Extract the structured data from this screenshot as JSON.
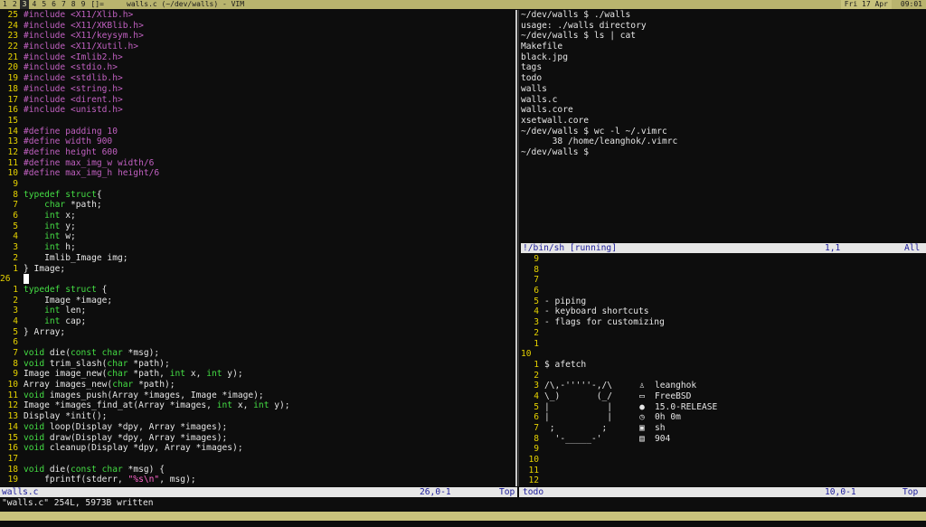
{
  "topbar": {
    "tags": [
      "1",
      "2",
      "3",
      "4",
      "5",
      "6",
      "7",
      "8",
      "9",
      "[]="
    ],
    "active_tag": "3",
    "window_title": "walls.c (~/dev/walls) - VIM",
    "date": "Fri 17 Apr",
    "time": "09:01"
  },
  "editor": {
    "lines": [
      {
        "n": "25",
        "t": [
          [
            "pp",
            "#include <X11/Xlib.h>"
          ]
        ]
      },
      {
        "n": "24",
        "t": [
          [
            "pp",
            "#include <X11/XKBlib.h>"
          ]
        ]
      },
      {
        "n": "23",
        "t": [
          [
            "pp",
            "#include <X11/keysym.h>"
          ]
        ]
      },
      {
        "n": "22",
        "t": [
          [
            "pp",
            "#include <X11/Xutil.h>"
          ]
        ]
      },
      {
        "n": "21",
        "t": [
          [
            "pp",
            "#include <Imlib2.h>"
          ]
        ]
      },
      {
        "n": "20",
        "t": [
          [
            "pp",
            "#include <stdio.h>"
          ]
        ]
      },
      {
        "n": "19",
        "t": [
          [
            "pp",
            "#include <stdlib.h>"
          ]
        ]
      },
      {
        "n": "18",
        "t": [
          [
            "pp",
            "#include <string.h>"
          ]
        ]
      },
      {
        "n": "17",
        "t": [
          [
            "pp",
            "#include <dirent.h>"
          ]
        ]
      },
      {
        "n": "16",
        "t": [
          [
            "pp",
            "#include <unistd.h>"
          ]
        ]
      },
      {
        "n": "15",
        "t": []
      },
      {
        "n": "14",
        "t": [
          [
            "pp",
            "#define padding 10"
          ]
        ]
      },
      {
        "n": "13",
        "t": [
          [
            "pp",
            "#define width 900"
          ]
        ]
      },
      {
        "n": "12",
        "t": [
          [
            "pp",
            "#define height 600"
          ]
        ]
      },
      {
        "n": "11",
        "t": [
          [
            "pp",
            "#define max_img_w width/6"
          ]
        ]
      },
      {
        "n": "10",
        "t": [
          [
            "pp",
            "#define max_img_h height/6"
          ]
        ]
      },
      {
        "n": "9",
        "t": []
      },
      {
        "n": "8",
        "t": [
          [
            "kw",
            "typedef struct"
          ],
          [
            "",
            "{"
          ]
        ]
      },
      {
        "n": "7",
        "t": [
          [
            "",
            "    "
          ],
          [
            "ty",
            "char"
          ],
          [
            "",
            " *path;"
          ]
        ]
      },
      {
        "n": "6",
        "t": [
          [
            "",
            "    "
          ],
          [
            "ty",
            "int"
          ],
          [
            "",
            " x;"
          ]
        ]
      },
      {
        "n": "5",
        "t": [
          [
            "",
            "    "
          ],
          [
            "ty",
            "int"
          ],
          [
            "",
            " y;"
          ]
        ]
      },
      {
        "n": "4",
        "t": [
          [
            "",
            "    "
          ],
          [
            "ty",
            "int"
          ],
          [
            "",
            " w;"
          ]
        ]
      },
      {
        "n": "3",
        "t": [
          [
            "",
            "    "
          ],
          [
            "ty",
            "int"
          ],
          [
            "",
            " h;"
          ]
        ]
      },
      {
        "n": "2",
        "t": [
          [
            "",
            "    Imlib_Image img;"
          ]
        ]
      },
      {
        "n": "1",
        "t": [
          [
            "",
            "} Image;"
          ]
        ]
      },
      {
        "n": "26",
        "cur": true,
        "t": [
          [
            "cursor",
            ""
          ]
        ]
      },
      {
        "n": "1",
        "t": [
          [
            "kw",
            "typedef struct"
          ],
          [
            "",
            " {"
          ]
        ]
      },
      {
        "n": "2",
        "t": [
          [
            "",
            "    Image *image;"
          ]
        ]
      },
      {
        "n": "3",
        "t": [
          [
            "",
            "    "
          ],
          [
            "ty",
            "int"
          ],
          [
            "",
            " len;"
          ]
        ]
      },
      {
        "n": "4",
        "t": [
          [
            "",
            "    "
          ],
          [
            "ty",
            "int"
          ],
          [
            "",
            " cap;"
          ]
        ]
      },
      {
        "n": "5",
        "t": [
          [
            "",
            "} Array;"
          ]
        ]
      },
      {
        "n": "6",
        "t": []
      },
      {
        "n": "7",
        "t": [
          [
            "ty",
            "void"
          ],
          [
            "",
            " die("
          ],
          [
            "ty",
            "const char"
          ],
          [
            "",
            " *msg);"
          ]
        ]
      },
      {
        "n": "8",
        "t": [
          [
            "ty",
            "void"
          ],
          [
            "",
            " trim_slash("
          ],
          [
            "ty",
            "char"
          ],
          [
            "",
            " *path);"
          ]
        ]
      },
      {
        "n": "9",
        "t": [
          [
            "",
            "Image image_new("
          ],
          [
            "ty",
            "char"
          ],
          [
            "",
            " *path, "
          ],
          [
            "ty",
            "int"
          ],
          [
            "",
            " x, "
          ],
          [
            "ty",
            "int"
          ],
          [
            "",
            " y);"
          ]
        ]
      },
      {
        "n": "10",
        "t": [
          [
            "",
            "Array images_new("
          ],
          [
            "ty",
            "char"
          ],
          [
            "",
            " *path);"
          ]
        ]
      },
      {
        "n": "11",
        "t": [
          [
            "ty",
            "void"
          ],
          [
            "",
            " images_push(Array *images, Image *image);"
          ]
        ]
      },
      {
        "n": "12",
        "t": [
          [
            "",
            "Image *images_find_at(Array *images, "
          ],
          [
            "ty",
            "int"
          ],
          [
            "",
            " x, "
          ],
          [
            "ty",
            "int"
          ],
          [
            "",
            " y);"
          ]
        ]
      },
      {
        "n": "13",
        "t": [
          [
            "",
            "Display *init();"
          ]
        ]
      },
      {
        "n": "14",
        "t": [
          [
            "ty",
            "void"
          ],
          [
            "",
            " loop(Display *dpy, Array *images);"
          ]
        ]
      },
      {
        "n": "15",
        "t": [
          [
            "ty",
            "void"
          ],
          [
            "",
            " draw(Display *dpy, Array *images);"
          ]
        ]
      },
      {
        "n": "16",
        "t": [
          [
            "ty",
            "void"
          ],
          [
            "",
            " cleanup(Display *dpy, Array *images);"
          ]
        ]
      },
      {
        "n": "17",
        "t": []
      },
      {
        "n": "18",
        "t": [
          [
            "ty",
            "void"
          ],
          [
            "",
            " die("
          ],
          [
            "ty",
            "const char"
          ],
          [
            "",
            " *msg) {"
          ]
        ]
      },
      {
        "n": "19",
        "t": [
          [
            "",
            "    fprintf(stderr, "
          ],
          [
            "str",
            "\"%s\\n\""
          ],
          [
            "",
            ", msg);"
          ]
        ]
      }
    ],
    "status_file": "walls.c",
    "status_pos": "26,0-1",
    "status_scroll": "Top",
    "cmdline": "\"walls.c\" 254L, 5973B written"
  },
  "terminal": {
    "lines": [
      "~/dev/walls $ ./walls",
      "usage: ./walls directory",
      "~/dev/walls $ ls | cat",
      "Makefile",
      "black.jpg",
      "tags",
      "todo",
      "walls",
      "walls.c",
      "walls.core",
      "xsetwall.core",
      "~/dev/walls $ wc -l ~/.vimrc",
      "      38 /home/leanghok/.vimrc",
      "~/dev/walls $"
    ],
    "status_name": "!/bin/sh [running]",
    "status_pos": "1,1",
    "status_scroll": "All"
  },
  "todo": {
    "lines": [
      {
        "n": "9",
        "t": ""
      },
      {
        "n": "8",
        "t": ""
      },
      {
        "n": "7",
        "t": ""
      },
      {
        "n": "6",
        "t": ""
      },
      {
        "n": "5",
        "t": "- piping"
      },
      {
        "n": "4",
        "t": "- keyboard shortcuts"
      },
      {
        "n": "3",
        "t": "- flags for customizing"
      },
      {
        "n": "2",
        "t": ""
      },
      {
        "n": "1",
        "t": ""
      },
      {
        "n": "10",
        "cur": true,
        "t": ""
      },
      {
        "n": "1",
        "t": "$ afetch"
      },
      {
        "n": "2",
        "t": ""
      },
      {
        "n": "3",
        "t": "/\\,-'''''-,/\\"
      },
      {
        "n": "4",
        "t": "\\_)       (_/"
      },
      {
        "n": "5",
        "t": "|           |"
      },
      {
        "n": "6",
        "t": "|           |"
      },
      {
        "n": "7",
        "t": " ;         ;"
      },
      {
        "n": "8",
        "t": "  '-_____-'"
      },
      {
        "n": "9",
        "t": ""
      },
      {
        "n": "10",
        "t": ""
      },
      {
        "n": "11",
        "t": ""
      },
      {
        "n": "12",
        "t": ""
      }
    ],
    "fetch": [
      {
        "icon": "user-icon",
        "glyph": "♙",
        "value": "leanghok"
      },
      {
        "icon": "computer-icon",
        "glyph": "▭",
        "value": "FreeBSD"
      },
      {
        "icon": "apple-icon",
        "glyph": "●",
        "value": "15.0-RELEASE"
      },
      {
        "icon": "clock-icon",
        "glyph": "◷",
        "value": "0h 0m"
      },
      {
        "icon": "terminal-icon",
        "glyph": "▣",
        "value": "sh"
      },
      {
        "icon": "package-icon",
        "glyph": "▤",
        "value": "904"
      }
    ],
    "status_name": "todo",
    "status_pos": "10,0-1",
    "status_scroll": "Top"
  }
}
